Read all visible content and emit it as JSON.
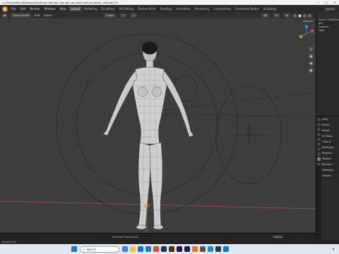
{
  "window": {
    "title": "C:\\Users\\Admin\\Downloads\\cute girl blender cute girl non-pack texture.blend] - Blender 4.0",
    "controls": [
      "—",
      "□",
      "✕"
    ]
  },
  "menubar": {
    "menus": [
      "File",
      "Edit",
      "Render",
      "Window",
      "Help"
    ],
    "workspaces": [
      "Layout",
      "Modeling",
      "Sculpting",
      "UV Editing",
      "Texture Paint",
      "Shading",
      "Animation",
      "Rendering",
      "Compositing",
      "Geometry Nodes",
      "Scripting"
    ],
    "active_workspace": "Layout",
    "scene_label": "Scene"
  },
  "viewport_header": {
    "mode": "Object Mode",
    "items": [
      "Add",
      "Object"
    ],
    "transform": "Global",
    "options_label": "Options"
  },
  "timeline": {
    "label": "Timeline Preferences",
    "view_layer": "TESTS"
  },
  "statusbar": {
    "text": "Rotate View"
  },
  "outliner": {
    "rows": [
      "Scene Collection",
      "girl",
      "Camera",
      "Light"
    ]
  },
  "properties": {
    "object_name": "body",
    "rows": [
      "body",
      "Vertex",
      "Shape",
      "UV Maps",
      "Color A",
      "Attributes",
      "Normals",
      "Texture",
      "Remesh",
      "Geometry",
      "Custom"
    ]
  },
  "taskbar": {
    "search_placeholder": "Search",
    "apps": [
      {
        "name": "widgets",
        "color": "#3b82f6"
      },
      {
        "name": "file-explorer",
        "color": "#f4c430"
      },
      {
        "name": "edge",
        "color": "#0a7bd1"
      },
      {
        "name": "store",
        "color": "#2f6fd0"
      },
      {
        "name": "chrome",
        "color": "#e24a3b"
      },
      {
        "name": "photoshop",
        "color": "#0e3a5c"
      },
      {
        "name": "illustrator",
        "color": "#5b2c00"
      },
      {
        "name": "premiere",
        "color": "#2a0d4a"
      },
      {
        "name": "after-effects",
        "color": "#1e1a4d"
      },
      {
        "name": "blender",
        "color": "#e87d0d"
      },
      {
        "name": "zbrush",
        "color": "#555555"
      },
      {
        "name": "vscode",
        "color": "#1f8ad2"
      },
      {
        "name": "terminal",
        "color": "#333333"
      },
      {
        "name": "mail",
        "color": "#0078d4"
      }
    ],
    "tray": {
      "time": "",
      "date": ""
    }
  },
  "colors": {
    "viewport_bg": "#3d3d3d",
    "grid_line": "#4a4a4a",
    "x_axis": "#b24a4a",
    "y_axis": "#7aa64a",
    "accent": "#e87d0d",
    "mesh_fill": "#cfcfcf"
  }
}
